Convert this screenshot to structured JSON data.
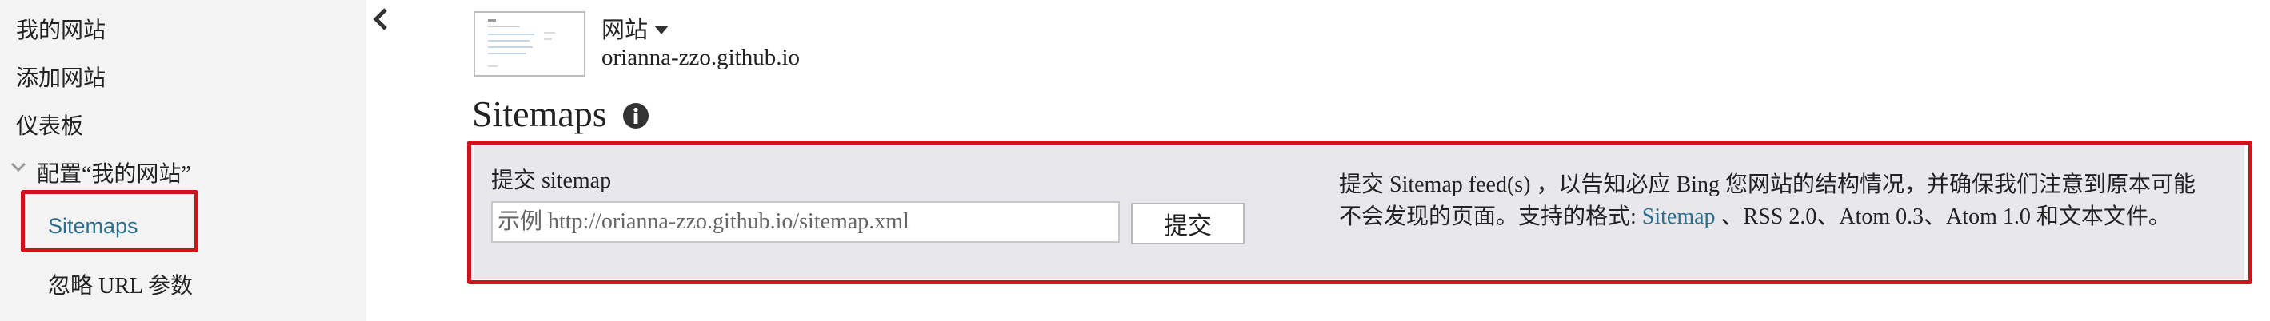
{
  "sidebar": {
    "items": [
      {
        "label": "我的网站"
      },
      {
        "label": "添加网站"
      },
      {
        "label": "仪表板"
      },
      {
        "label": "配置“我的网站”"
      },
      {
        "label": "Sitemaps"
      },
      {
        "label": "忽略 URL 参数"
      }
    ]
  },
  "site": {
    "name": "网站",
    "url": "orianna-zzo.github.io"
  },
  "page": {
    "title": "Sitemaps"
  },
  "submit_panel": {
    "label": "提交 sitemap",
    "input_placeholder": "示例 http://orianna-zzo.github.io/sitemap.xml",
    "input_value": "",
    "submit_label": "提交",
    "description_before": "提交 Sitemap feed(s) ，以告知必应 Bing 您网站的结构情况，并确保我们注意到原本可能不会发现的页面。支持的格式: ",
    "description_link": "Sitemap",
    "description_after": " 、RSS 2.0、Atom 0.3、Atom 1.0 和文本文件。"
  },
  "colors": {
    "highlight": "#d0121a",
    "link": "#2b6f8a",
    "panel_bg": "#e8e8ec",
    "sidebar_bg": "#f3f3f3"
  },
  "icons": [
    "collapse-chevron-left-icon",
    "chevron-down-icon",
    "caret-down-icon",
    "info-icon"
  ]
}
